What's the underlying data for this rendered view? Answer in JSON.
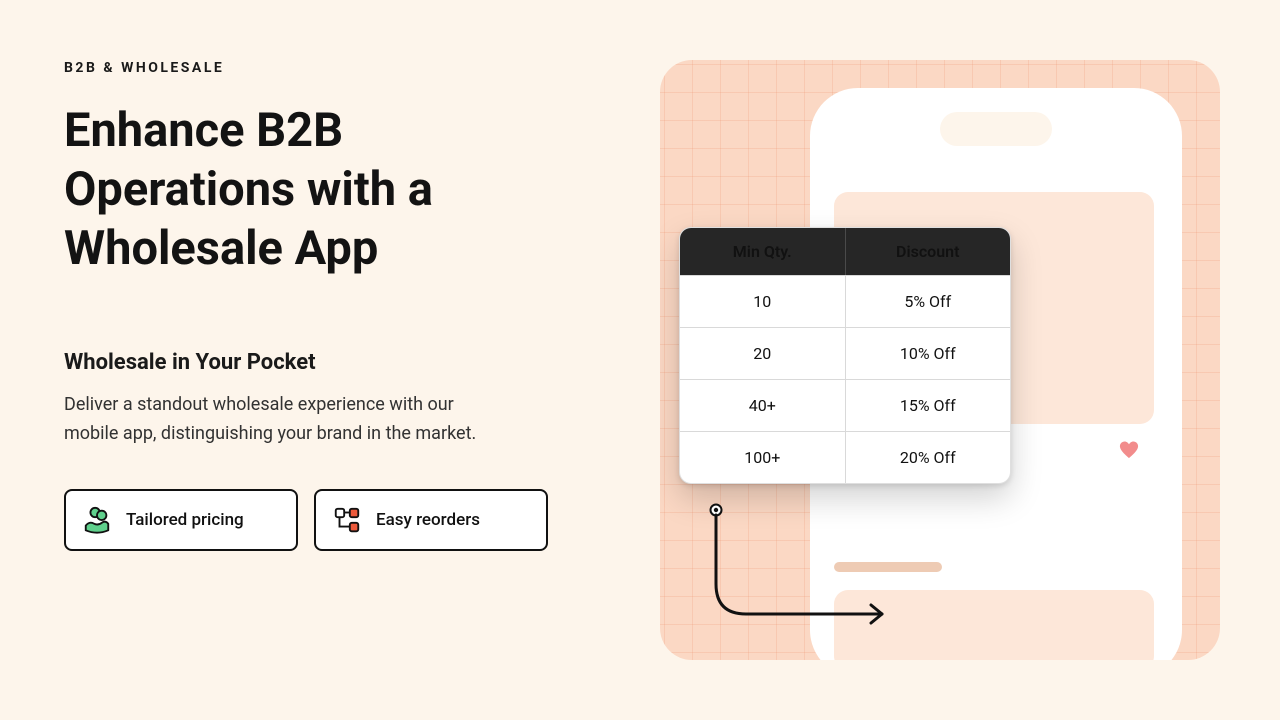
{
  "eyebrow": "B2B & WHOLESALE",
  "headline": "Enhance B2B Operations with a Wholesale App",
  "subhead": "Wholesale in Your Pocket",
  "body": "Deliver a standout wholesale experience with our mobile app, distinguishing your brand in the market.",
  "chips": [
    {
      "label": "Tailored pricing",
      "icon": "pricing-icon"
    },
    {
      "label": "Easy reorders",
      "icon": "reorder-icon"
    }
  ],
  "pricing_table": {
    "columns": [
      "Min Qty.",
      "Discount"
    ],
    "rows": [
      {
        "qty": "10",
        "discount": "5% Off"
      },
      {
        "qty": "20",
        "discount": "10% Off"
      },
      {
        "qty": "40+",
        "discount": "15% Off"
      },
      {
        "qty": "100+",
        "discount": "20% Off"
      }
    ]
  }
}
